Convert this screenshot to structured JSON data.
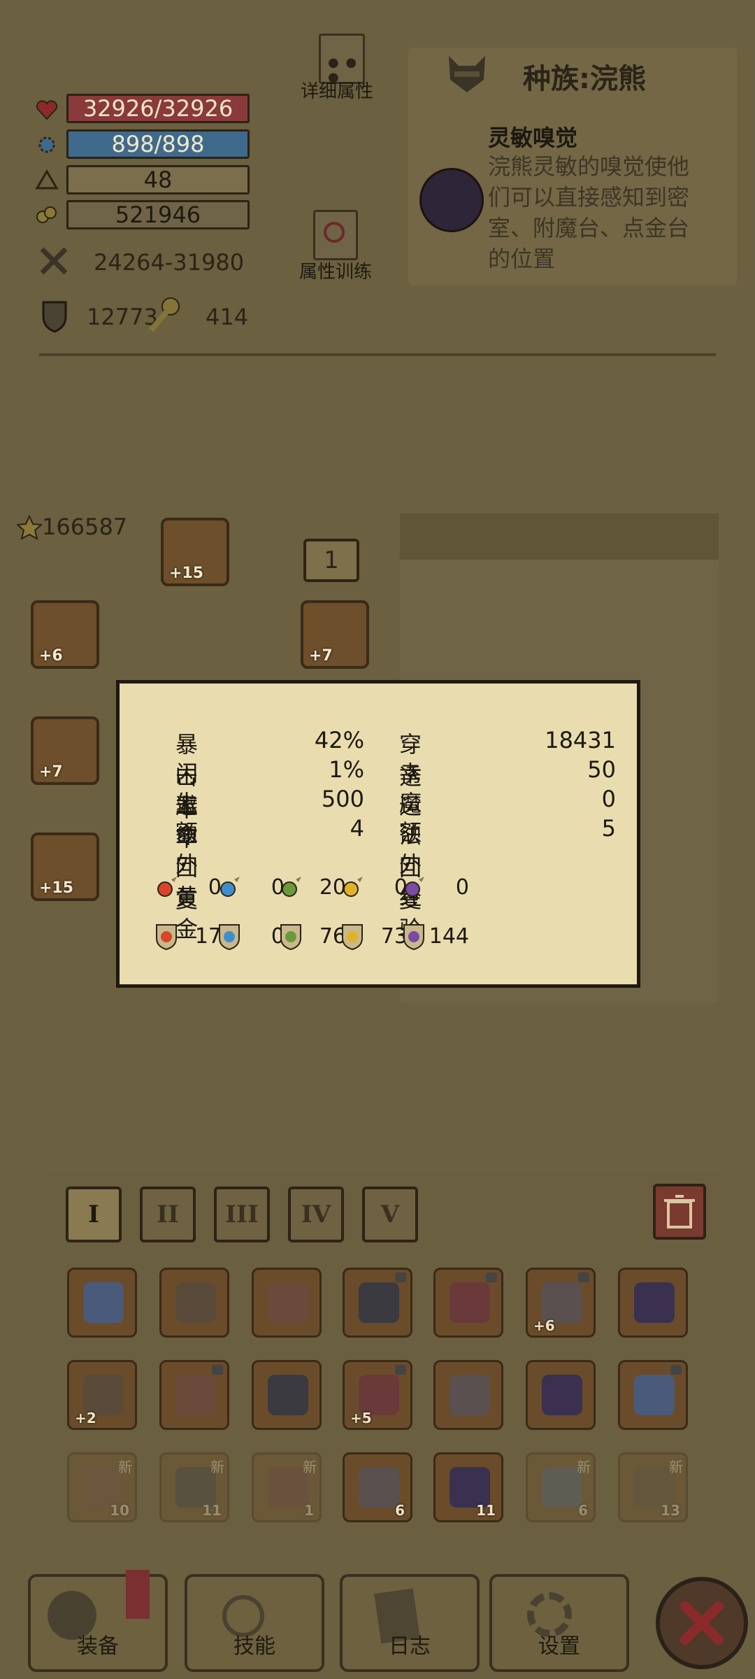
{
  "stats": {
    "hp": "32926/32926",
    "mp": "898/898",
    "level": "48",
    "gold": "521946",
    "attack": "24264-31980",
    "defense": "12773",
    "resource": "414"
  },
  "buttons": {
    "details": "详细属性",
    "training": "属性训练"
  },
  "race": {
    "title": "种族:浣熊",
    "trait_name": "灵敏嗅觉",
    "trait_desc_1": "浣熊灵敏的嗅觉使他",
    "trait_desc_2": "们可以直接感知到密",
    "trait_desc_3": "室、附魔台、点金台",
    "trait_desc_4": "的位置"
  },
  "equipment": {
    "score": "166587",
    "page_badge": "1",
    "slots": [
      {
        "plus": "+15"
      },
      {
        "plus": "+6"
      },
      {
        "plus": "+7"
      },
      {
        "plus": "+7"
      },
      {
        "plus": "+15"
      }
    ]
  },
  "popup": {
    "rows": [
      {
        "k1": "暴击率",
        "v1": "42%",
        "k2": "穿透",
        "v2": "18431"
      },
      {
        "k1": "闪避率",
        "v1": "1%",
        "k2": "幸运",
        "v2": "50"
      },
      {
        "k1": "生命回复",
        "v1": "500",
        "k2": "魔法回复",
        "v2": "0"
      },
      {
        "k1": "额外黄金",
        "v1": "4",
        "k2": "额外经验",
        "v2": "5"
      }
    ],
    "element_attack": [
      "0",
      "0",
      "20",
      "0",
      "0"
    ],
    "element_resist": [
      "17",
      "0",
      "76",
      "73",
      "144"
    ],
    "element_colors": [
      "#d8452a",
      "#3e8fcc",
      "#6a9a3a",
      "#e0b22a",
      "#7a4aa6"
    ]
  },
  "inventory": {
    "tabs": [
      "I",
      "II",
      "III",
      "IV",
      "V"
    ],
    "row1_plus": [
      "",
      "",
      "",
      "",
      "",
      "+6",
      ""
    ],
    "row2_plus": [
      "+2",
      "",
      "",
      "+5",
      "",
      "",
      ""
    ],
    "row3_counts": [
      "10",
      "11",
      "1",
      "6",
      "11",
      "6",
      "13"
    ],
    "new_badge": "新"
  },
  "nav": {
    "equip": "装备",
    "skills": "技能",
    "log": "日志",
    "settings": "设置"
  }
}
